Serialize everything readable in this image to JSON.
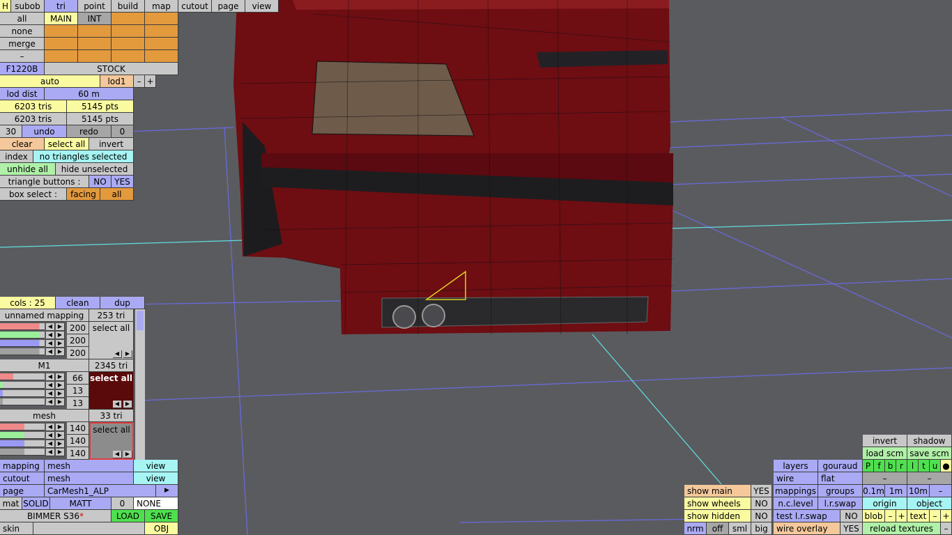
{
  "top_tabs": [
    "H",
    "subob",
    "tri",
    "point",
    "build",
    "map",
    "cutout",
    "page",
    "view"
  ],
  "left_col": [
    "all",
    "none",
    "merge",
    "–"
  ],
  "tabs2": [
    "MAIN",
    "INT"
  ],
  "asset": {
    "code": "F1220B",
    "variant": "STOCK"
  },
  "lod": {
    "mode": "auto",
    "level": "lod1",
    "minus": "–",
    "plus": "+",
    "dist_label": "lod dist",
    "dist_value": "60 m"
  },
  "stats": [
    {
      "tris": "6203 tris",
      "pts": "5145 pts"
    },
    {
      "tris": "6203 tris",
      "pts": "5145 pts"
    }
  ],
  "history": {
    "count": "30",
    "undo": "undo",
    "redo": "redo",
    "num": "0"
  },
  "sel": {
    "clear": "clear",
    "select_all": "select all",
    "invert": "invert"
  },
  "index": {
    "label": "index",
    "status": "no triangles selected"
  },
  "hide": {
    "unhide": "unhide all",
    "hide_unsel": "hide unselected"
  },
  "tri_buttons": {
    "label": "triangle buttons :",
    "no": "NO",
    "yes": "YES"
  },
  "box_select": {
    "label": "box select :",
    "facing": "facing",
    "all": "all"
  },
  "cols": {
    "label": "cols : 25",
    "clean": "clean",
    "dup": "dup"
  },
  "materials": [
    {
      "name": "unnamed mapping",
      "tri": "253 tri",
      "vals": [
        "200",
        "200",
        "200"
      ],
      "select": "select all"
    },
    {
      "name": "M1",
      "tri": "2345 tri",
      "vals": [
        "66",
        "13",
        "13"
      ],
      "select": "select all"
    },
    {
      "name": "mesh",
      "tri": "33 tri",
      "vals": [
        "140",
        "140",
        "140"
      ],
      "select": "select all"
    }
  ],
  "arrows": {
    "left": "◀",
    "right": "▶"
  },
  "bottom_left": {
    "mapping_label": "mapping",
    "mapping_value": "mesh",
    "cutout_label": "cutout",
    "cutout_value": "mesh",
    "view": "view",
    "page_label": "page",
    "page_value": "CarMesh1_ALP",
    "page_arrow": "▶",
    "mat": "mat",
    "solid": "SOLID",
    "matt": "MATT",
    "mat_num": "0",
    "none": "NONE",
    "car_name": "BIMMER S36",
    "modified_mark": "*",
    "load": "LOAD",
    "save": "SAVE",
    "skin": "skin",
    "obj": "OBJ"
  },
  "bottom_right": {
    "show_main": "show main",
    "show_wheels": "show wheels",
    "show_hidden": "show hidden",
    "yes": "YES",
    "no": "NO",
    "nrm": "nrm",
    "off": "off",
    "sml": "sml",
    "big": "big",
    "layers": "layers",
    "gouraud": "gouraud",
    "wire": "wire",
    "flat": "flat",
    "mappings": "mappings",
    "groups": "groups",
    "nc_level": "n.c.level",
    "lr_swap": "l.r.swap",
    "test_lr_swap": "test l.r.swap",
    "wire_overlay": "wire overlay",
    "invert": "invert",
    "shadow": "shadow",
    "load_scm": "load scm",
    "save_scm": "save scm",
    "flags": [
      "P",
      "f",
      "b",
      "r",
      "l",
      "t",
      "u",
      "●"
    ],
    "dash": "–",
    "scale": [
      "0.1m",
      "1m",
      "10m"
    ],
    "origin": "origin",
    "object": "object",
    "blob": "blob",
    "text": "text",
    "plus": "+",
    "reload": "reload textures"
  },
  "colors": {
    "background": "#5a5b5f",
    "car_body": "#6e0d12",
    "grid_blue": "#6a6ae0",
    "grid_cyan": "#60e0e0",
    "selection": "#e0d020"
  }
}
